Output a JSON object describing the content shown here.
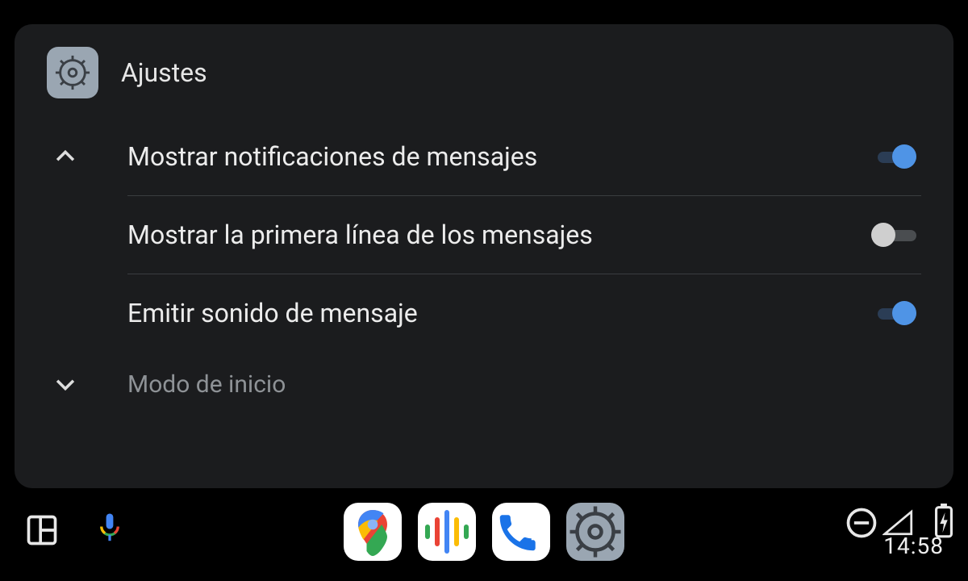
{
  "header": {
    "title": "Ajustes"
  },
  "sections": {
    "expanded": {
      "items": [
        {
          "label": "Mostrar notificaciones de mensajes",
          "toggle": "on"
        },
        {
          "label": "Mostrar la primera línea de los mensajes",
          "toggle": "off"
        },
        {
          "label": "Emitir sonido de mensaje",
          "toggle": "on"
        }
      ]
    },
    "collapsed": {
      "label": "Modo de inicio"
    }
  },
  "statusbar": {
    "time": "14:58"
  },
  "dock": {
    "apps": [
      "maps",
      "podcasts",
      "phone",
      "settings"
    ]
  }
}
